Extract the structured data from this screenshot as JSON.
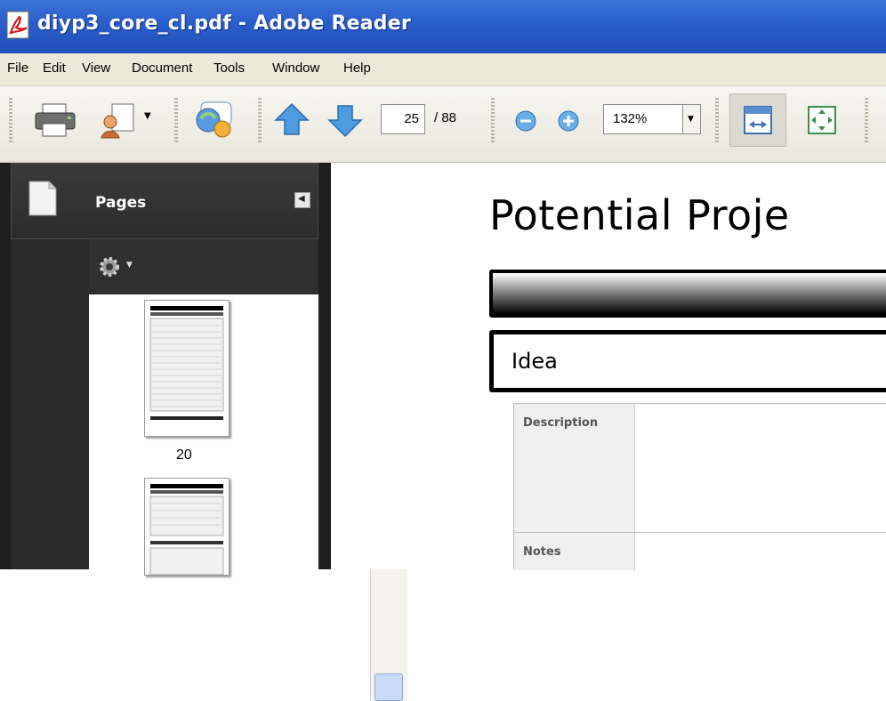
{
  "window": {
    "title": "diyp3_core_cl.pdf - Adobe Reader"
  },
  "menu": [
    "File",
    "Edit",
    "View",
    "Document",
    "Tools",
    "Window",
    "Help"
  ],
  "toolbar": {
    "current_page": "25",
    "total_pages": "/ 88",
    "zoom": "132%"
  },
  "nav_panel": {
    "title": "Pages"
  },
  "thumbnails": [
    {
      "label": "20"
    }
  ],
  "document": {
    "heading": "Potential Proje",
    "section": "Idea",
    "rows": [
      "Description",
      "Notes"
    ]
  },
  "colors": {
    "titlebar": "#2b5fcb",
    "toolbar": "#e9e7dc",
    "nav_panel": "#1f1f1f"
  }
}
